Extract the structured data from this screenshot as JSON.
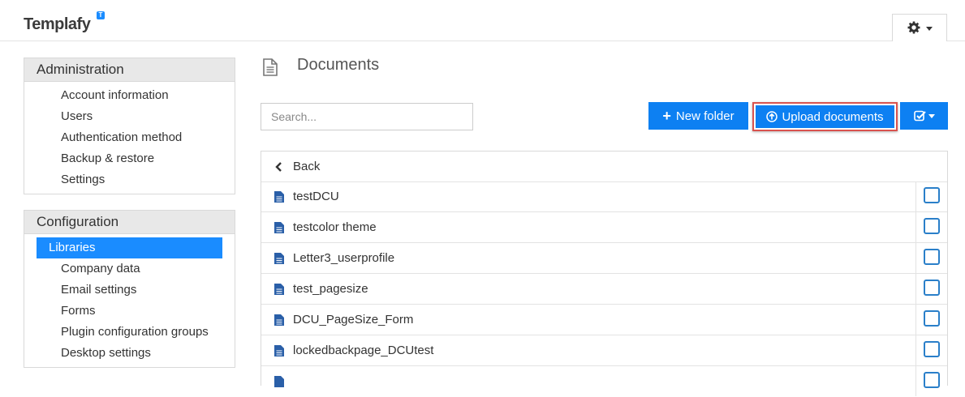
{
  "header": {
    "logo": "Templafy",
    "logo_badge": "T"
  },
  "sidebar": {
    "administration": {
      "title": "Administration",
      "items": [
        {
          "label": "Account information"
        },
        {
          "label": "Users"
        },
        {
          "label": "Authentication method"
        },
        {
          "label": "Backup & restore"
        },
        {
          "label": "Settings"
        }
      ]
    },
    "configuration": {
      "title": "Configuration",
      "items": [
        {
          "label": "Libraries",
          "active": true
        },
        {
          "label": "Company data"
        },
        {
          "label": "Email settings"
        },
        {
          "label": "Forms"
        },
        {
          "label": "Plugin configuration groups"
        },
        {
          "label": "Desktop settings"
        }
      ]
    }
  },
  "main": {
    "title": "Documents",
    "search_placeholder": "Search...",
    "new_folder_label": "New folder",
    "upload_label": "Upload documents",
    "back_label": "Back",
    "files": [
      {
        "name": "testDCU"
      },
      {
        "name": "testcolor theme"
      },
      {
        "name": "Letter3_userprofile"
      },
      {
        "name": "test_pagesize"
      },
      {
        "name": "DCU_PageSize_Form"
      },
      {
        "name": "lockedbackpage_DCUtest"
      }
    ]
  },
  "colors": {
    "accent": "#0d80f2",
    "highlight_border": "#d9534f"
  }
}
